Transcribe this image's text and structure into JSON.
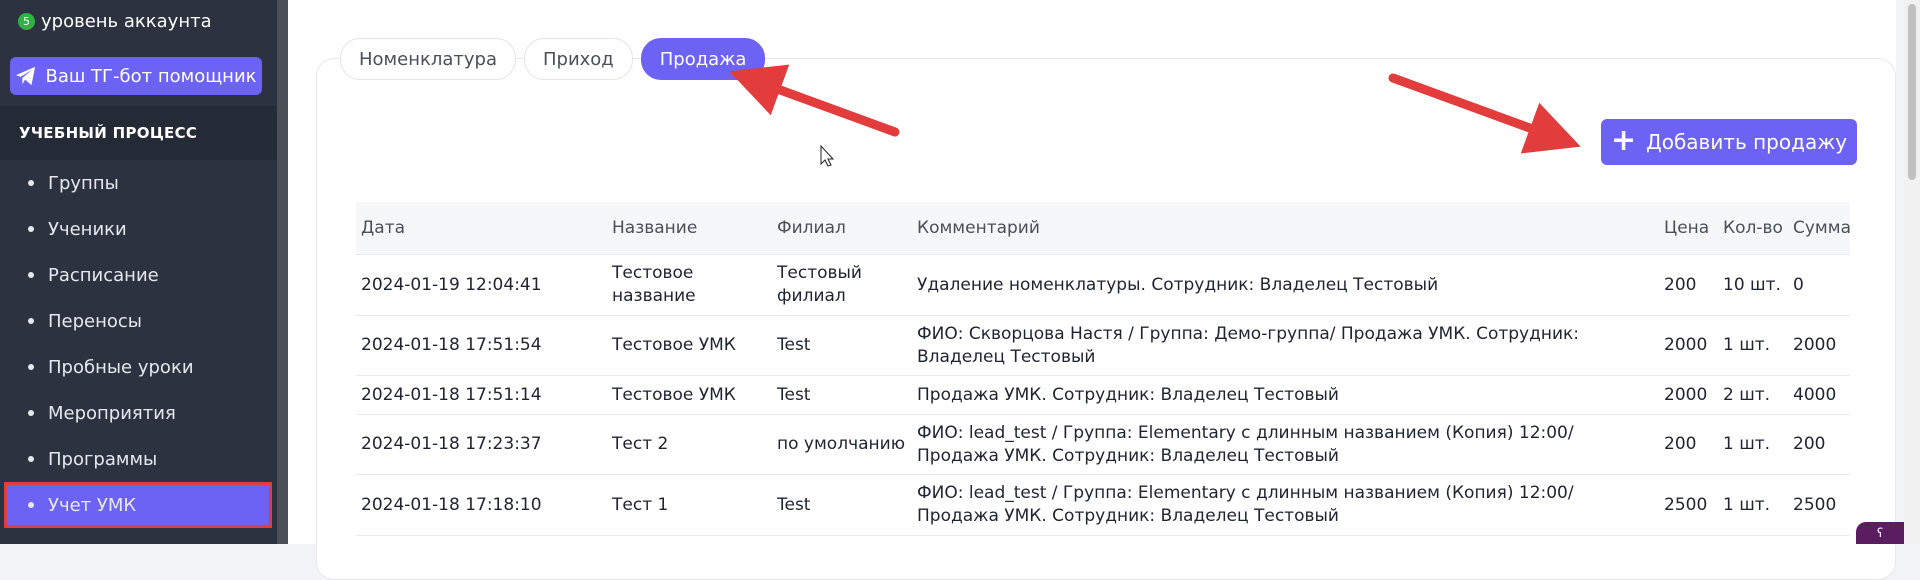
{
  "sidebar": {
    "level_badge": "5",
    "level_text": "уровень аккаунта",
    "tg_button": "Ваш ТГ-бот помощник",
    "section": "УЧЕБНЫЙ ПРОЦЕСС",
    "items": [
      {
        "label": "Группы"
      },
      {
        "label": "Ученики"
      },
      {
        "label": "Расписание"
      },
      {
        "label": "Переносы"
      },
      {
        "label": "Пробные уроки"
      },
      {
        "label": "Мероприятия"
      },
      {
        "label": "Программы"
      },
      {
        "label": "Учет УМК",
        "active": true
      }
    ]
  },
  "tabs": [
    {
      "label": "Номенклатура"
    },
    {
      "label": "Приход"
    },
    {
      "label": "Продажа",
      "active": true
    }
  ],
  "add_button": "Добавить продажу",
  "table": {
    "headers": [
      "Дата",
      "Название",
      "Филиал",
      "Комментарий",
      "Цена",
      "Кол-во",
      "Сумма"
    ],
    "rows": [
      [
        "2024-01-19 12:04:41",
        "Тестовое название",
        "Тестовый филиал",
        "Удаление номенклатуры. Сотрудник: Владелец Тестовый",
        "200",
        "10 шт.",
        "0"
      ],
      [
        "2024-01-18 17:51:54",
        "Тестовое УМК",
        "Test",
        "ФИО: Скворцова Настя / Группа: Демо-группа/ Продажа УМК. Сотрудник: Владелец Тестовый",
        "2000",
        "1 шт.",
        "2000"
      ],
      [
        "2024-01-18 17:51:14",
        "Тестовое УМК",
        "Test",
        "Продажа УМК. Сотрудник: Владелец Тестовый",
        "2000",
        "2 шт.",
        "4000"
      ],
      [
        "2024-01-18 17:23:37",
        "Тест 2",
        "по умолчанию",
        "ФИО: lead_test / Группа: Elementary с длинным названием (Копия) 12:00/ Продажа УМК. Сотрудник: Владелец Тестовый",
        "200",
        "1 шт.",
        "200"
      ],
      [
        "2024-01-18 17:18:10",
        "Тест 1",
        "Test",
        "ФИО: lead_test / Группа: Elementary с длинным названием (Копия) 12:00/ Продажа УМК. Сотрудник: Владелец Тестовый",
        "2500",
        "1 шт.",
        "2500"
      ]
    ]
  },
  "colors": {
    "accent": "#6c63f5",
    "annotation_red": "#e23c3c",
    "sidebar_bg": "#2c3240"
  }
}
